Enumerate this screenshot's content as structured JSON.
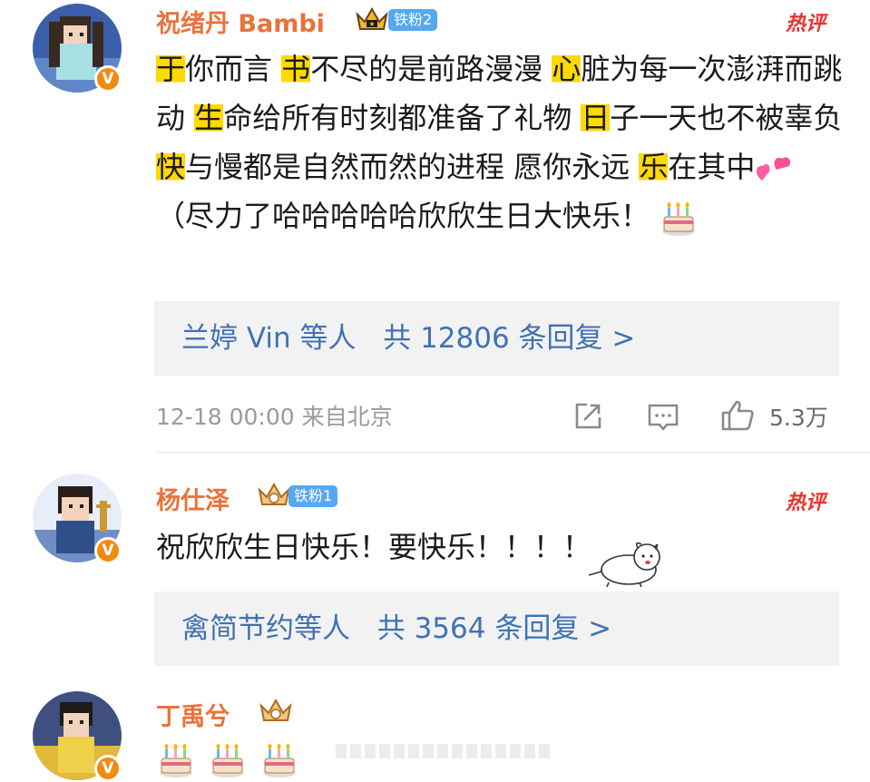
{
  "comments": [
    {
      "user": "祝绪丹 Bambi",
      "fan_badge": "铁粉2",
      "hot_tag": "热评",
      "text_segments": [
        {
          "t": "于",
          "hl": true
        },
        {
          "t": "你而言 ",
          "hl": false
        },
        {
          "t": "书",
          "hl": true
        },
        {
          "t": "不尽的是前路漫漫 ",
          "hl": false
        },
        {
          "t": "心",
          "hl": true
        },
        {
          "t": "脏为每一次澎湃而跳动 ",
          "hl": false
        },
        {
          "t": "生",
          "hl": true
        },
        {
          "t": "命给所有时刻都准备了礼物 ",
          "hl": false
        },
        {
          "t": "日",
          "hl": true
        },
        {
          "t": "子一天也不被辜负 ",
          "hl": false
        },
        {
          "t": "快",
          "hl": true
        },
        {
          "t": "与慢都是自然而然的进程 愿你永远 ",
          "hl": false
        },
        {
          "t": "乐",
          "hl": true
        },
        {
          "t": "在其中",
          "hl": false
        }
      ],
      "text_tail": "（尽力了哈哈哈哈哈欣欣生日大快乐！",
      "reply_others": "兰婷 Vin 等人",
      "reply_count": "共 12806 条回复 >",
      "timestamp": "12-18 00:00 来自北京",
      "likes": "5.3万",
      "icons": [
        "share-icon",
        "comment-icon",
        "like-icon",
        "cake-emoji",
        "heart-emoji"
      ]
    },
    {
      "user": "杨仕泽",
      "fan_badge": "铁粉1",
      "hot_tag": "热评",
      "text": "祝欣欣生日快乐！要快乐！！！！",
      "reply_others": "禽简节约等人",
      "reply_count": "共 3564 条回复 >"
    },
    {
      "user": "丁禹兮"
    }
  ],
  "colors": {
    "username": "#e8733b",
    "link": "#3f72b4",
    "highlight": "#ffd900",
    "hot": "#e8332d",
    "fan_badge": "#56a8f0",
    "v_badge": "#f28a10"
  }
}
